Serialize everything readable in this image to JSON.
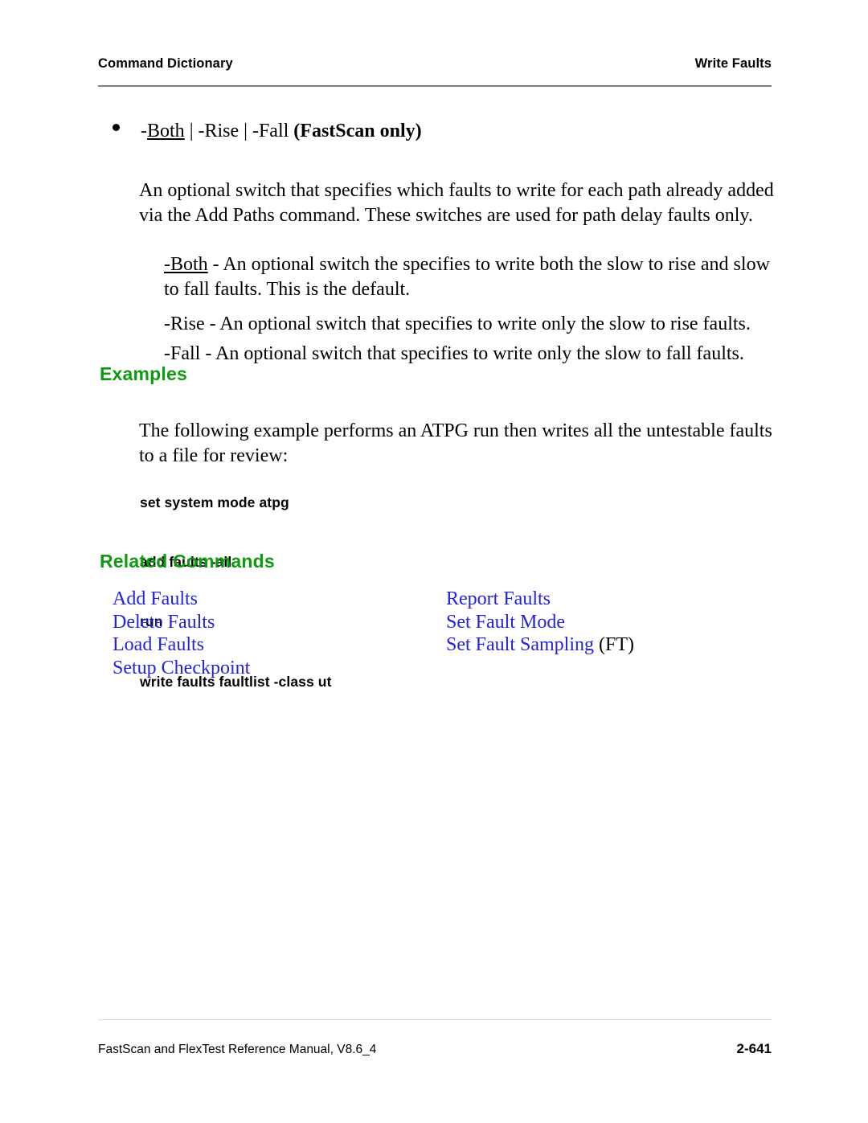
{
  "header": {
    "left": "Command Dictionary",
    "right": "Write Faults"
  },
  "bullet": {
    "marker": "bullet-dot",
    "prefix": "-",
    "switch_both": "Both",
    "sep1": " | -",
    "switch_rise": "Rise",
    "sep2": " | -",
    "switch_fall": "Fall",
    "qualifier": " (FastScan only)"
  },
  "body": {
    "switch_description": "An optional switch that specifies which faults to write for each path already added via the Add Paths command. These switches are used for path delay faults only.",
    "def_both_term": "-Both",
    "def_both_text": " - An optional switch the specifies to write both the slow to rise and slow to fall faults. This is the default.",
    "def_rise": "-Rise - An optional switch that specifies to write only the slow to rise faults.",
    "def_fall": "-Fall - An optional switch that specifies to write only the slow to fall faults."
  },
  "examples": {
    "heading": "Examples",
    "intro": "The following example performs an ATPG run then writes all the untestable faults to a file for review:",
    "code_lines": [
      "set system mode atpg",
      "add faults -all",
      "run",
      "write faults faultlist -class ut"
    ]
  },
  "related": {
    "heading": "Related Commands",
    "column_left": [
      {
        "label": "Add Faults",
        "suffix": ""
      },
      {
        "label": "Delete Faults",
        "suffix": ""
      },
      {
        "label": "Load Faults",
        "suffix": ""
      },
      {
        "label": "Setup Checkpoint",
        "suffix": ""
      }
    ],
    "column_right": [
      {
        "label": "Report Faults",
        "suffix": ""
      },
      {
        "label": "Set Fault Mode",
        "suffix": ""
      },
      {
        "label": "Set Fault Sampling",
        "suffix": " (FT)"
      }
    ]
  },
  "footer": {
    "manual": "FastScan and FlexTest Reference Manual, V8.6_4",
    "page_number": "2-641"
  },
  "colors": {
    "heading_green": "#0f9b0f",
    "link_blue": "#2222dd",
    "rule_gray": "#7f7f7f",
    "text_black": "#000000"
  }
}
